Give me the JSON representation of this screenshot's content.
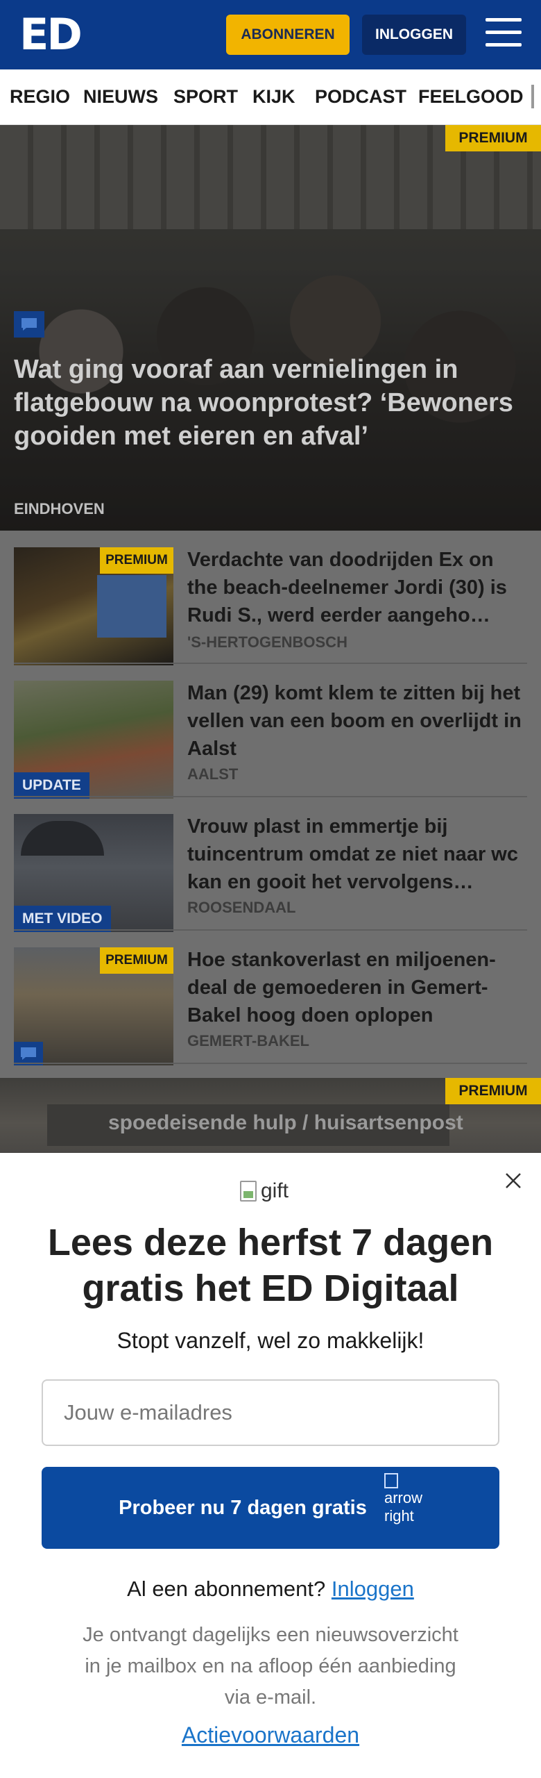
{
  "header": {
    "logo": "ED",
    "subscribe_label": "ABONNEREN",
    "login_label": "INLOGGEN"
  },
  "nav": {
    "items": [
      "REGIO",
      "NIEUWS",
      "SPORT",
      "KIJK",
      "PODCAST",
      "FEELGOOD"
    ]
  },
  "hero": {
    "badge": "PREMIUM",
    "title": "Wat ging vooraf aan vernielingen in flatgebouw na woonprotest? ‘Bewoners gooiden met eieren en afval’",
    "location": "EINDHOVEN"
  },
  "articles": [
    {
      "badge": "PREMIUM",
      "title": "Verdachte van doodrijden Ex on the beach-deelnemer Jordi (30) is Rudi S., werd eerder aangeho…",
      "location": "'S-HERTOGENBOSCH"
    },
    {
      "tag": "UPDATE",
      "title": "Man (29) komt klem te zitten bij het vellen van een boom en overlijdt in Aalst",
      "location": "AALST"
    },
    {
      "tag": "MET VIDEO",
      "title": "Vrouw plast in emmertje bij tuincentrum omdat ze niet naar wc kan en gooit het vervolgens…",
      "location": "ROOSENDAAL"
    },
    {
      "badge": "PREMIUM",
      "title": "Hoe stankoverlast en miljoenen-deal de gemoederen in Gemert-Bakel hoog doen oplopen",
      "location": "GEMERT-BAKEL"
    }
  ],
  "bottom_teaser": {
    "badge": "PREMIUM",
    "sign_text": "spoedeisende hulp / huisartsenpost"
  },
  "modal": {
    "gift_alt": "gift",
    "title": "Lees deze herfst 7 dagen gratis het ED Digitaal",
    "subtitle": "Stopt vanzelf, wel zo makkelijk!",
    "email_placeholder": "Jouw e-mailadres",
    "cta_label": "Probeer nu 7 dagen gratis",
    "cta_arrow_alt": "arrow right",
    "cta_arrow_text": "arro\nrigh",
    "subscription_question": "Al een abonnement?",
    "subscription_login": "Inloggen",
    "info": "Je ontvangt dagelijks een nieuwsoverzicht in je mailbox en na afloop één aanbieding via e-mail.",
    "terms": "Actievoorwaarden"
  },
  "colors": {
    "brand_blue": "#0b3a8a",
    "premium_yellow": "#e6b800",
    "subscribe_yellow": "#f2b400",
    "cta_blue": "#0b4aa0",
    "link_blue": "#1a74c9"
  },
  "icons": [
    "menu-icon",
    "chat-icon",
    "close-icon",
    "gift-image",
    "arrow-right-image"
  ]
}
